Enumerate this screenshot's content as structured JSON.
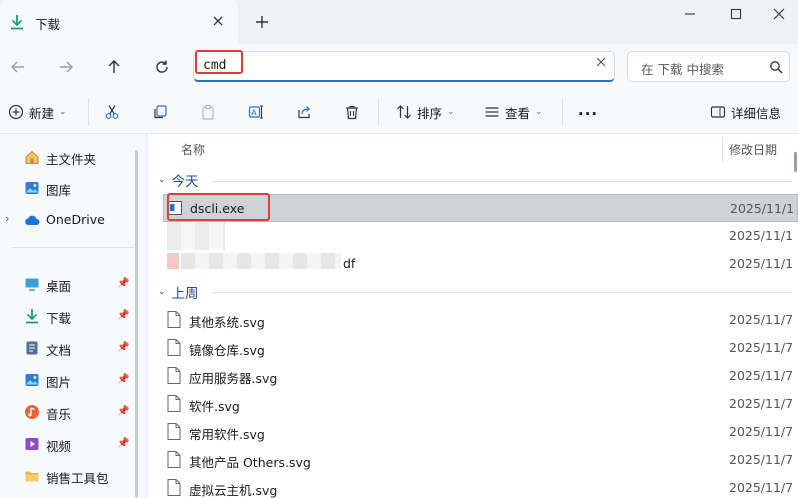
{
  "window": {
    "tab_title": "下载",
    "colors": {
      "accent": "#2e6fc4",
      "highlight": "#e03c3c",
      "folder": "#e9b84a",
      "download": "#1a9b83"
    }
  },
  "address": {
    "path": "cmd",
    "search_placeholder": "在 下载 中搜索"
  },
  "toolbar": {
    "new_label": "新建",
    "sort_label": "排序",
    "view_label": "查看",
    "more_label": "...",
    "details_label": "详细信息"
  },
  "sidebar": {
    "items": [
      {
        "label": "主文件夹",
        "icon": "home-icon"
      },
      {
        "label": "图库",
        "icon": "gallery-icon"
      },
      {
        "label": "OneDrive",
        "icon": "cloud-icon"
      }
    ],
    "pinned": [
      {
        "label": "桌面",
        "icon": "desktop-icon"
      },
      {
        "label": "下载",
        "icon": "download-icon"
      },
      {
        "label": "文档",
        "icon": "document-icon"
      },
      {
        "label": "图片",
        "icon": "picture-icon"
      },
      {
        "label": "音乐",
        "icon": "music-icon"
      },
      {
        "label": "视频",
        "icon": "video-icon"
      },
      {
        "label": "销售工具包",
        "icon": "folder-icon"
      }
    ]
  },
  "columns": {
    "name": "名称",
    "modified": "修改日期"
  },
  "groups": [
    {
      "label": "今天",
      "files": [
        {
          "name": "dscli.exe",
          "date": "2025/11/1",
          "selected": true
        },
        {
          "name": "",
          "date": "2025/11/1",
          "blurred": true
        },
        {
          "name": "df",
          "date": "2025/11/1",
          "blurred": true
        }
      ]
    },
    {
      "label": "上周",
      "files": [
        {
          "name": "其他系统.svg",
          "date": "2025/11/7"
        },
        {
          "name": "镜像仓库.svg",
          "date": "2025/11/7"
        },
        {
          "name": "应用服务器.svg",
          "date": "2025/11/7"
        },
        {
          "name": "软件.svg",
          "date": "2025/11/7"
        },
        {
          "name": "常用软件.svg",
          "date": "2025/11/7"
        },
        {
          "name": "其他产品 Others.svg",
          "date": "2025/11/7"
        },
        {
          "name": "虚拟云主机.svg",
          "date": "2025/11/7"
        }
      ]
    }
  ]
}
